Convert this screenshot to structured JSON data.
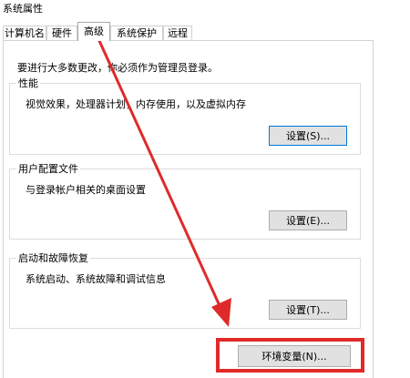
{
  "window": {
    "title": "系统属性"
  },
  "tabs": [
    {
      "label": "计算机名"
    },
    {
      "label": "硬件"
    },
    {
      "label": "高级",
      "active": true
    },
    {
      "label": "系统保护"
    },
    {
      "label": "远程"
    }
  ],
  "advanced": {
    "admin_note": "要进行大多数更改，你必须作为管理员登录。",
    "performance": {
      "title": "性能",
      "description": "视觉效果，处理器计划，内存使用，以及虚拟内存",
      "button_label": "设置(S)..."
    },
    "user_profiles": {
      "title": "用户配置文件",
      "description": "与登录帐户相关的桌面设置",
      "button_label": "设置(E)..."
    },
    "startup_recovery": {
      "title": "启动和故障恢复",
      "description": "系统启动、系统故障和调试信息",
      "button_label": "设置(T)..."
    },
    "env_button_label": "环境变量(N)..."
  },
  "annotation": {
    "color": "#e02a2a",
    "arrow_icon": "arrow-icon",
    "target": "环境变量(N)..."
  }
}
